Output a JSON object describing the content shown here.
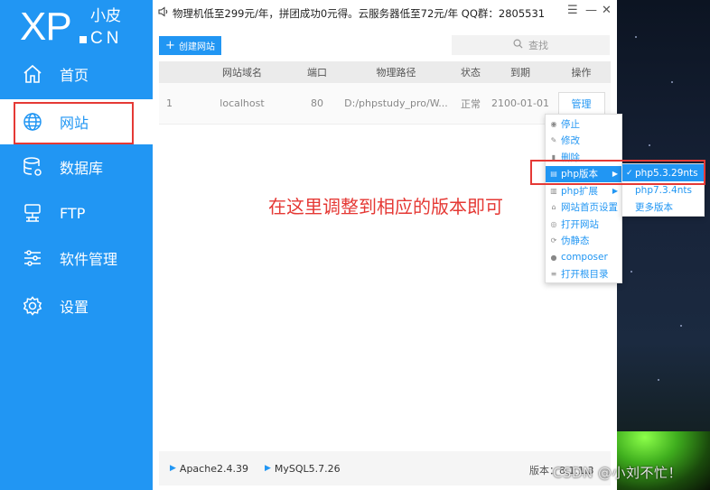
{
  "app": {
    "logo_main": "XP",
    "logo_sub_cn": "小皮",
    "logo_sub_en": "CN"
  },
  "sidebar": {
    "items": [
      {
        "label": "首页",
        "icon": "home-icon"
      },
      {
        "label": "网站",
        "icon": "globe-icon",
        "active": true
      },
      {
        "label": "数据库",
        "icon": "database-icon"
      },
      {
        "label": "FTP",
        "icon": "server-icon"
      },
      {
        "label": "软件管理",
        "icon": "sliders-icon"
      },
      {
        "label": "设置",
        "icon": "gear-icon"
      }
    ]
  },
  "topbar": {
    "announcement": "物理机低至299元/年，拼团成功0元得。云服务器低至72元/年 QQ群：2805531"
  },
  "toolbar": {
    "new_site_label": "创建网站",
    "search_placeholder": "查找"
  },
  "table": {
    "headers": [
      "",
      "网站域名",
      "端口",
      "物理路径",
      "状态",
      "到期",
      "操作"
    ],
    "rows": [
      {
        "id": "1",
        "domain": "localhost",
        "port": "80",
        "path": "D:/phpstudy_pro/W...",
        "status": "正常",
        "expires": "2100-01-01",
        "action": "管理"
      }
    ]
  },
  "context_menu": {
    "items": [
      {
        "label": "停止",
        "icon": "stop-icon"
      },
      {
        "label": "修改",
        "icon": "edit-icon"
      },
      {
        "label": "删除",
        "icon": "trash-icon"
      },
      {
        "label": "php版本",
        "icon": "php-icon",
        "submenu": true,
        "highlighted": true
      },
      {
        "label": "php扩展",
        "icon": "puzzle-icon",
        "submenu": true
      },
      {
        "label": "网站首页设置",
        "icon": "home-icon"
      },
      {
        "label": "打开网站",
        "icon": "open-icon"
      },
      {
        "label": "伪静态",
        "icon": "rewrite-icon"
      },
      {
        "label": "composer",
        "icon": "composer-icon"
      },
      {
        "label": "打开根目录",
        "icon": "folder-icon"
      }
    ]
  },
  "php_version_submenu": {
    "items": [
      {
        "label": "php5.3.29nts",
        "checked": true,
        "highlighted": true
      },
      {
        "label": "php7.3.4nts",
        "checked": false
      },
      {
        "label": "更多版本",
        "checked": false
      }
    ]
  },
  "annotation": {
    "text": "在这里调整到相应的版本即可",
    "color": "#e53935"
  },
  "statusbar": {
    "apache": "Apache2.4.39",
    "mysql": "MySQL5.7.26",
    "version": "版本：8.1.1.3"
  },
  "watermark": "CSDN @小刘不忙！",
  "colors": {
    "accent": "#2196f3",
    "highlight_border": "#e53935"
  }
}
